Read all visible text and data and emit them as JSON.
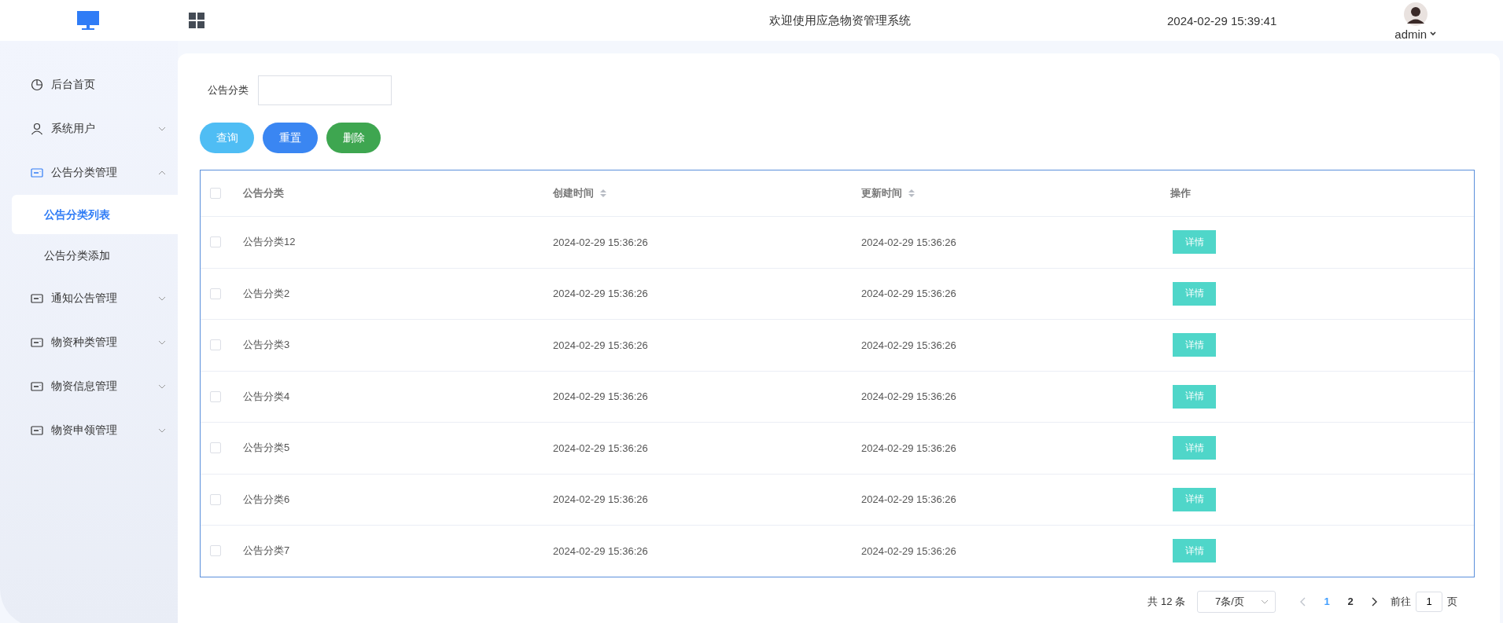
{
  "header": {
    "title": "欢迎使用应急物资管理系统",
    "datetime": "2024-02-29 15:39:41",
    "user": "admin"
  },
  "sidebar": {
    "items": [
      {
        "label": "后台首页",
        "kind": "link"
      },
      {
        "label": "系统用户",
        "kind": "submenu",
        "expanded": false
      },
      {
        "label": "公告分类管理",
        "kind": "submenu",
        "expanded": true,
        "children": [
          {
            "label": "公告分类列表",
            "selected": true
          },
          {
            "label": "公告分类添加",
            "selected": false
          }
        ]
      },
      {
        "label": "通知公告管理",
        "kind": "submenu",
        "expanded": false
      },
      {
        "label": "物资种类管理",
        "kind": "submenu",
        "expanded": false
      },
      {
        "label": "物资信息管理",
        "kind": "submenu",
        "expanded": false
      },
      {
        "label": "物资申领管理",
        "kind": "submenu",
        "expanded": false
      }
    ]
  },
  "filter": {
    "label": "公告分类"
  },
  "buttons": [
    {
      "label": "查询",
      "kind": "query"
    },
    {
      "label": "重置",
      "kind": "reset"
    },
    {
      "label": "删除",
      "kind": "delete"
    }
  ],
  "table": {
    "all_checked": false,
    "columns": [
      {
        "label": "公告分类"
      },
      {
        "label": "创建时间",
        "sortable": true
      },
      {
        "label": "更新时间",
        "sortable": true
      },
      {
        "label": "操作"
      }
    ],
    "rows": [
      {
        "checked": false,
        "name": "公告分类12",
        "created": "2024-02-29 15:36:26",
        "updated": "2024-02-29 15:36:26",
        "action": "详情"
      },
      {
        "checked": false,
        "name": "公告分类2",
        "created": "2024-02-29 15:36:26",
        "updated": "2024-02-29 15:36:26",
        "action": "详情"
      },
      {
        "checked": false,
        "name": "公告分类3",
        "created": "2024-02-29 15:36:26",
        "updated": "2024-02-29 15:36:26",
        "action": "详情"
      },
      {
        "checked": false,
        "name": "公告分类4",
        "created": "2024-02-29 15:36:26",
        "updated": "2024-02-29 15:36:26",
        "action": "详情"
      },
      {
        "checked": false,
        "name": "公告分类5",
        "created": "2024-02-29 15:36:26",
        "updated": "2024-02-29 15:36:26",
        "action": "详情"
      },
      {
        "checked": false,
        "name": "公告分类6",
        "created": "2024-02-29 15:36:26",
        "updated": "2024-02-29 15:36:26",
        "action": "详情"
      },
      {
        "checked": false,
        "name": "公告分类7",
        "created": "2024-02-29 15:36:26",
        "updated": "2024-02-29 15:36:26",
        "action": "详情"
      }
    ]
  },
  "pagination": {
    "total": "共 12 条",
    "page_size": "7条/页",
    "prev_disabled": true,
    "next_disabled": false,
    "pages": [
      {
        "label": "1",
        "selected": true
      },
      {
        "label": "2",
        "selected": false
      }
    ],
    "goto_label": "前往",
    "goto_value": "1",
    "goto_suffix": "页"
  }
}
